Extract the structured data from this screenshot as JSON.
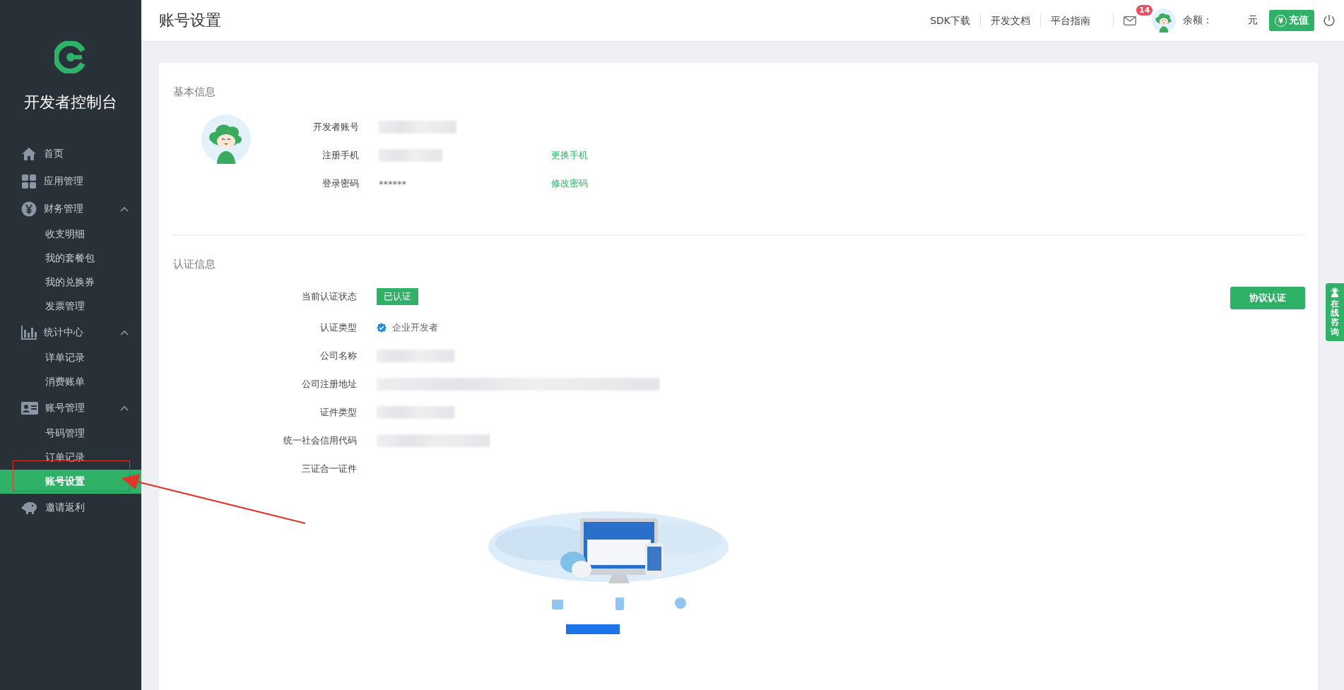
{
  "sidebar": {
    "title": "开发者控制台",
    "items": [
      {
        "label": "首页",
        "selected": false
      },
      {
        "label": "应用管理",
        "selected": false
      },
      {
        "label": "财务管理",
        "selected": false,
        "expanded": true,
        "children": [
          {
            "label": "收支明细",
            "selected": false
          },
          {
            "label": "我的套餐包",
            "selected": false
          },
          {
            "label": "我的兑换券",
            "selected": false
          },
          {
            "label": "发票管理",
            "selected": false
          }
        ]
      },
      {
        "label": "统计中心",
        "selected": false,
        "expanded": true,
        "children": [
          {
            "label": "详单记录",
            "selected": false
          },
          {
            "label": "消费账单",
            "selected": false
          }
        ]
      },
      {
        "label": "账号管理",
        "selected": false,
        "expanded": true,
        "children": [
          {
            "label": "号码管理",
            "selected": false
          },
          {
            "label": "订单记录",
            "selected": false
          },
          {
            "label": "账号设置",
            "selected": true
          }
        ]
      },
      {
        "label": "邀请返利",
        "selected": false
      }
    ]
  },
  "header": {
    "title": "账号设置",
    "links": [
      "SDK下载",
      "开发文档",
      "平台指南"
    ],
    "mail_count": "14",
    "balance_label": "余额：",
    "balance_unit": "元",
    "recharge_icon": "¥",
    "recharge": "充值"
  },
  "basic_info": {
    "title": "基本信息",
    "fields": [
      {
        "label": "开发者账号",
        "kind": "redacted"
      },
      {
        "label": "注册手机",
        "kind": "redacted",
        "action": "更换手机"
      },
      {
        "label": "登录密码",
        "kind": "text",
        "value": "******",
        "action": "修改密码"
      }
    ]
  },
  "certification": {
    "title": "认证信息",
    "action": "协议认证",
    "fields": [
      {
        "label": "当前认证状态",
        "kind": "badge",
        "value": "已认证"
      },
      {
        "label": "认证类型",
        "kind": "verified",
        "value": "企业开发者"
      },
      {
        "label": "公司名称",
        "kind": "redacted"
      },
      {
        "label": "公司注册地址",
        "kind": "redacted"
      },
      {
        "label": "证件类型",
        "kind": "redacted"
      },
      {
        "label": "统一社会信用代码",
        "kind": "redacted"
      },
      {
        "label": "三证合一证件",
        "kind": "empty"
      }
    ]
  },
  "consult_tab": "在线咨询"
}
